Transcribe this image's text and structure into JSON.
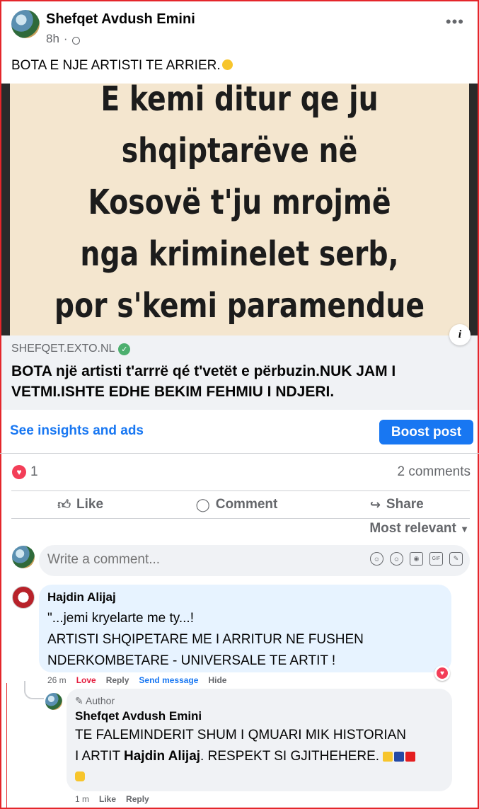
{
  "post": {
    "author": "Shefqet Avdush Emini",
    "time": "8h",
    "more_label": "•••",
    "text": "BOTA E NJE ARTISTI TE ARRIER.",
    "image_lines": [
      "E kemi ditur qe ju",
      "shqiptarëve në",
      "Kosovë t'ju mrojmë",
      "nga kriminelet serb,",
      "por s'kemi paramendue"
    ],
    "link": {
      "domain": "SHEFQET.EXTO.NL",
      "title": "BOTA një artisti t'arrrë qé t'vetët e përbuzin.NUK JAM I VETMI.ISHTE EDHE BEKIM FEHMIU I NDJERI.",
      "info_label": "i"
    }
  },
  "insights": {
    "link_label": "See insights and ads",
    "boost_label": "Boost post"
  },
  "stats": {
    "reaction_count": "1",
    "comments_label": "2 comments"
  },
  "actions": {
    "like": "Like",
    "comment": "Comment",
    "share": "Share"
  },
  "sort": {
    "label": "Most relevant"
  },
  "composer": {
    "placeholder": "Write a comment..."
  },
  "comments": [
    {
      "name": "Hajdin Alijaj",
      "lines": [
        "\"...jemi kryelarte me ty...!",
        "ARTISTI SHQIPETARE ME I ARRITUR NE FUSHEN",
        "NDERKOMBETARE - UNIVERSALE TE ARTIT !"
      ],
      "time": "26 m",
      "love": "Love",
      "reply": "Reply",
      "send": "Send message",
      "hide": "Hide"
    },
    {
      "tag": "Author",
      "name": "Shefqet Avdush Emini",
      "line1": "TE FALEMINDERIT SHUM I QMUARI MIK HISTORIAN",
      "line2_prefix": "I ARTIT ",
      "line2_bold": "Hajdin Alijaj",
      "line2_suffix": ". RESPEKT SI GJITHEHERE.",
      "time": "1 m",
      "like": "Like",
      "reply": "Reply"
    }
  ],
  "colors": {
    "accent": "#1877f2",
    "frame": "#e4262b",
    "love": "#f33e58"
  }
}
